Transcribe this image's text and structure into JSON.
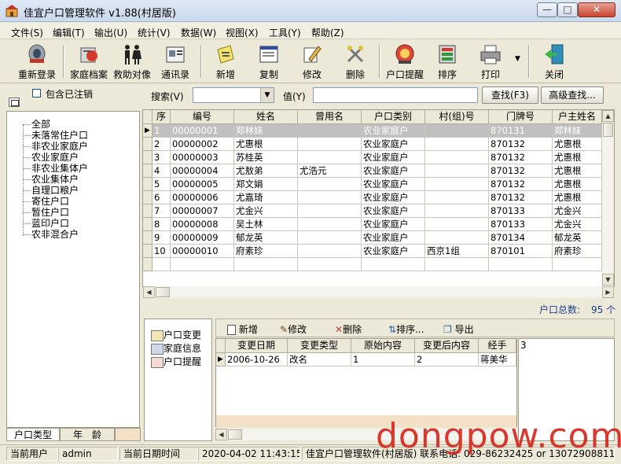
{
  "window": {
    "title": "佳宜户口管理软件 v1.88(村居版)",
    "controls": [
      "0",
      "□",
      "X"
    ]
  },
  "menu": [
    "文件(S)",
    "编辑(T)",
    "输出(U)",
    "统计(V)",
    "数据(W)",
    "视图(X)",
    "工具(Y)",
    "帮助(Z)"
  ],
  "toolbar": [
    {
      "label": "重新登录",
      "icon": "relogin-icon"
    },
    {
      "label": "家庭档案",
      "icon": "family-archive-icon"
    },
    {
      "label": "救助对像",
      "icon": "relief-people-icon"
    },
    {
      "label": "通讯录",
      "icon": "address-book-icon"
    },
    {
      "label": "新增",
      "icon": "add-icon"
    },
    {
      "label": "复制",
      "icon": "copy-icon"
    },
    {
      "label": "修改",
      "icon": "edit-icon"
    },
    {
      "label": "删除",
      "icon": "delete-icon"
    },
    {
      "label": "户口提醒",
      "icon": "reminder-icon"
    },
    {
      "label": "排序",
      "icon": "sort-icon"
    },
    {
      "label": "打印",
      "icon": "printer-icon"
    },
    {
      "label": "关闭",
      "icon": "exit-icon"
    }
  ],
  "filter": {
    "include_cancelled": "包含已注销",
    "search_label": "搜索(V)",
    "search_field_value": "",
    "value_label": "值(Y)",
    "value_input": "",
    "find_button": "查找(F3)",
    "advanced_button": "高级查找..."
  },
  "tree": {
    "root": "全部",
    "items": [
      "未落常住户口",
      "非农业家庭户",
      "农业家庭户",
      "非农业集体户",
      "农业集体户",
      "自理口粮户",
      "寄住户口",
      "暂住户口",
      "蓝印户口",
      "农非混合户"
    ]
  },
  "grid": {
    "columns": [
      "序",
      "编号",
      "姓名",
      "曾用名",
      "户口类别",
      "村(组)号",
      "门牌号",
      "户主姓名"
    ],
    "rows": [
      [
        "1",
        "00000001",
        "郑林妹",
        "",
        "农业家庭户",
        "",
        "870131",
        "郑林妹"
      ],
      [
        "2",
        "00000002",
        "尤惠根",
        "",
        "农业家庭户",
        "",
        "870132",
        "尤惠根"
      ],
      [
        "3",
        "00000003",
        "苏桂英",
        "",
        "农业家庭户",
        "",
        "870132",
        "尤惠根"
      ],
      [
        "4",
        "00000004",
        "尤敖弟",
        "尤浩元",
        "农业家庭户",
        "",
        "870132",
        "尤惠根"
      ],
      [
        "5",
        "00000005",
        "郑文娟",
        "",
        "农业家庭户",
        "",
        "870132",
        "尤惠根"
      ],
      [
        "6",
        "00000006",
        "尤嘉琦",
        "",
        "农业家庭户",
        "",
        "870132",
        "尤惠根"
      ],
      [
        "7",
        "00000007",
        "尤金兴",
        "",
        "农业家庭户",
        "",
        "870133",
        "尤金兴"
      ],
      [
        "8",
        "00000008",
        "吴土林",
        "",
        "农业家庭户",
        "",
        "870133",
        "尤金兴"
      ],
      [
        "9",
        "00000009",
        "郁龙英",
        "",
        "农业家庭户",
        "",
        "870134",
        "郁龙英"
      ],
      [
        "10",
        "00000010",
        "府素珍",
        "",
        "农业家庭户",
        "西京1组",
        "870101",
        "府素珍"
      ]
    ],
    "selected_row": 1,
    "total_label": "户口总数:",
    "total_value": "95 个"
  },
  "side_panel": [
    "户口变更",
    "家庭信息",
    "户口提醒"
  ],
  "sub_toolbar": [
    "新增",
    "修改",
    "删除",
    "排序...",
    "导出"
  ],
  "sub_grid": {
    "columns": [
      "变更日期",
      "变更类型",
      "原始内容",
      "变更后内容",
      "经手"
    ],
    "rows": [
      [
        "2006-10-26",
        "改名",
        "1",
        "2",
        "蒋美华"
      ]
    ]
  },
  "memo_value": "3",
  "tabs": [
    "户口类型",
    "年　龄"
  ],
  "status": {
    "user_label": "当前用户",
    "user_value": "admin",
    "date_label": "当前日期时间",
    "date_value": "2020-04-02 11:43:15",
    "product": "佳宜户口管理软件(村居版) 联系电话: 029-86232425 or 13072908811"
  },
  "watermark": "dongpow.com",
  "colors": {
    "selected_row": "#c0c0c0",
    "watermark": "#d7281d",
    "title_gradient": "#c9d8ec"
  }
}
